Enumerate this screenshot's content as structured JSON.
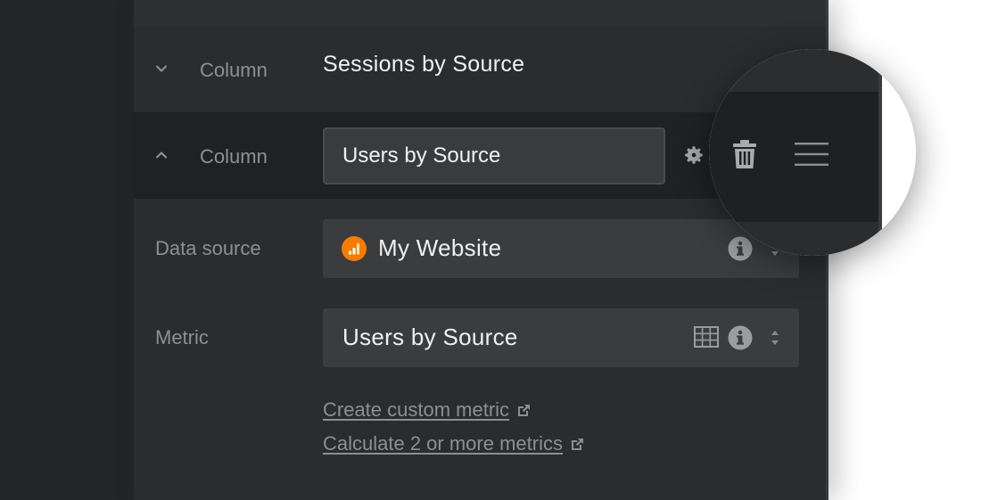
{
  "rows": [
    {
      "kind_label": "Column",
      "title": "Sessions by Source",
      "expanded": false,
      "icon": "chevron-down-icon"
    },
    {
      "kind_label": "Column",
      "title_value": "Users by Source",
      "expanded": true,
      "icon": "chevron-up-icon"
    }
  ],
  "row_actions": {
    "settings_icon": "gear-icon",
    "delete_icon": "trash-icon",
    "drag_icon": "hamburger-menu-icon"
  },
  "fields": {
    "data_source": {
      "label": "Data source",
      "value": "My Website",
      "source_icon": "google-analytics-icon",
      "info_icon": "info-icon"
    },
    "metric": {
      "label": "Metric",
      "value": "Users by Source",
      "table_icon": "grid-icon",
      "info_icon": "info-icon"
    }
  },
  "links": [
    {
      "label": "Create custom metric",
      "icon": "external-link-icon"
    },
    {
      "label": "Calculate 2 or more metrics",
      "icon": "external-link-icon"
    }
  ],
  "colors": {
    "panel_bg": "#2b2c2e",
    "selected_row_bg": "#202122",
    "field_bg": "#3b3c3e",
    "accent_orange": "#f57c00"
  }
}
